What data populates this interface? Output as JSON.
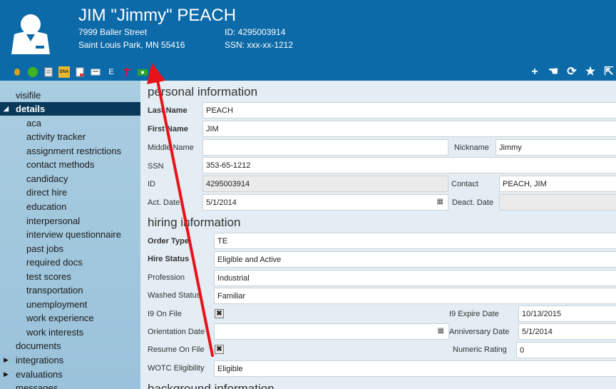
{
  "header": {
    "name": "JIM \"Jimmy\" PEACH",
    "address_line1": "7999 Baller Street",
    "address_line2": "Saint Louis Park, MN 55416",
    "id_line": "ID: 4295003914",
    "ssn_line": "SSN: xxx-xx-1212"
  },
  "toolbar_left": [
    "coin-icon",
    "green-status-icon",
    "document-icon",
    "dna-icon",
    "page-icon",
    "card-icon",
    "e-verify-icon",
    "caduceus-icon",
    "money-icon"
  ],
  "toolbar_left_text": {
    "e": "E",
    "dna": "DNA"
  },
  "toolbar_right": {
    "add": "+",
    "hand": "☚",
    "refresh": "⟳",
    "star": "★",
    "export": "⇱"
  },
  "sidebar": {
    "items": [
      {
        "label": "visifile"
      },
      {
        "label": "details"
      },
      {
        "label": "aca"
      },
      {
        "label": "activity tracker"
      },
      {
        "label": "assignment restrictions"
      },
      {
        "label": "contact methods"
      },
      {
        "label": "candidacy"
      },
      {
        "label": "direct hire"
      },
      {
        "label": "education"
      },
      {
        "label": "interpersonal"
      },
      {
        "label": "interview questionnaire"
      },
      {
        "label": "past jobs"
      },
      {
        "label": "required docs"
      },
      {
        "label": "test scores"
      },
      {
        "label": "transportation"
      },
      {
        "label": "unemployment"
      },
      {
        "label": "work experience"
      },
      {
        "label": "work interests"
      },
      {
        "label": "documents"
      },
      {
        "label": "integrations"
      },
      {
        "label": "evaluations"
      },
      {
        "label": "messages"
      }
    ]
  },
  "sections": {
    "personal": "personal information",
    "hiring": "hiring information",
    "background": "background information"
  },
  "personal": {
    "last_name_label": "Last Name",
    "last_name": "PEACH",
    "first_name_label": "First Name",
    "first_name": "JIM",
    "middle_name_label": "Middle Name",
    "middle_name": "",
    "nickname_label": "Nickname",
    "nickname": "Jimmy",
    "ssn_label": "SSN",
    "ssn": "353-65-1212",
    "id_label": "ID",
    "id": "4295003914",
    "contact_label": "Contact",
    "contact": "PEACH, JIM",
    "act_date_label": "Act. Date",
    "act_date": "5/1/2014",
    "deact_date_label": "Deact. Date",
    "deact_date": ""
  },
  "hiring": {
    "order_type_label": "Order Type",
    "order_type": "TE",
    "hire_status_label": "Hire Status",
    "hire_status": "Eligible and Active",
    "profession_label": "Profession",
    "profession": "Industrial",
    "washed_status_label": "Washed Status",
    "washed_status": "Familiar",
    "i9_on_file_label": "I9 On File",
    "i9_on_file": "✖",
    "i9_expire_label": "I9 Expire Date",
    "i9_expire": "10/13/2015",
    "orientation_label": "Orientation Date",
    "orientation": "",
    "anniversary_label": "Anniversary Date",
    "anniversary": "5/1/2014",
    "resume_label": "Resume On File",
    "resume": "✖",
    "numeric_rating_label": "Numeric Rating",
    "numeric_rating": "0",
    "wotc_label": "WOTC Eligibility",
    "wotc": "Eligible"
  },
  "calendar_glyph": "▦",
  "annotation_color": "#e8121a"
}
